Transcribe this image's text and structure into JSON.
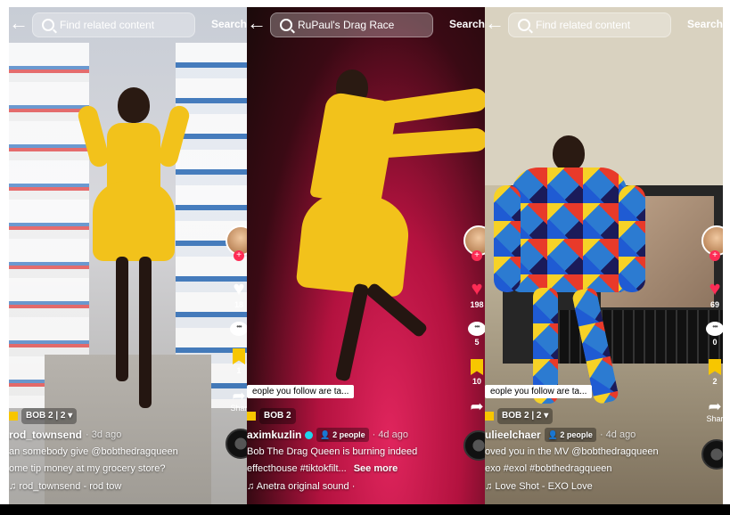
{
  "panels": [
    {
      "search_text": "Find related content",
      "search_button": "Search",
      "rail": {
        "likes": "18",
        "comments": "",
        "saves": "1",
        "share_label": "Shar"
      },
      "tag": {
        "label": "BOB 2",
        "count": "2"
      },
      "username": "rod_townsend",
      "date": "· 3d ago",
      "caption_line1": "an somebody give @bobthedragqueen",
      "caption_line2": "ome tip money at my grocery store?",
      "music": "rod_townsend - rod tow"
    },
    {
      "search_text": "RuPaul's Drag Race",
      "search_button": "Search",
      "rail": {
        "likes": "198",
        "comments": "5",
        "saves": "10",
        "share_label": ""
      },
      "tooltip": "eople you follow are ta...",
      "tag": {
        "label": "BOB 2"
      },
      "username": "aximkuzlin",
      "people_badge": "2 people",
      "date": "· 4d ago",
      "caption_line1": "Bob The Drag Queen is burning indeed",
      "caption_line2": "effecthouse #tiktokfilt...",
      "more": "See more",
      "music": "Anetra  original sound ·"
    },
    {
      "search_text": "Find related content",
      "search_button": "Search",
      "rail": {
        "likes": "69",
        "comments": "0",
        "saves": "2",
        "share_label": "Shar"
      },
      "tooltip": "eople you follow are ta...",
      "tag": {
        "label": "BOB 2",
        "count": "2"
      },
      "username": "ulieelchaer",
      "people_badge": "2 people",
      "date": "· 4d ago",
      "caption_line1": "oved you in the MV @bobthedragqueen",
      "caption_line2": "exo #exol #bobthedragqueen",
      "music": "Love Shot - EXO   Love"
    }
  ]
}
